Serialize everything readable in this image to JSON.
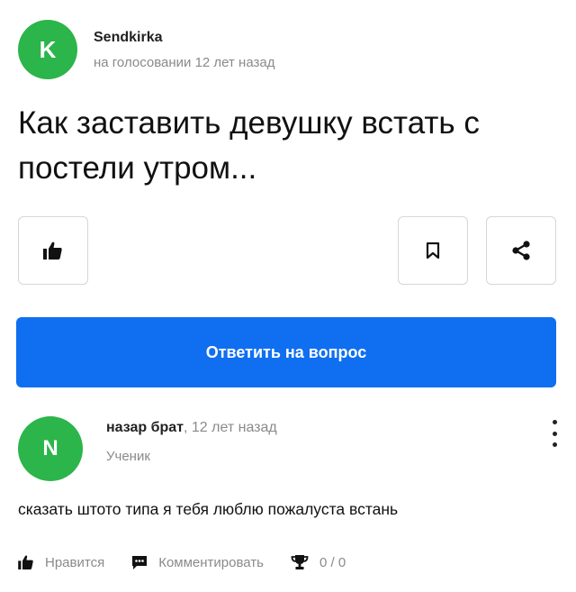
{
  "question": {
    "avatar_letter": "K",
    "avatar_color": "#2bb54a",
    "author": "Sendkirka",
    "subtitle": "на голосовании 12 лет назад",
    "title": "Как заставить девушку встать с постели утром..."
  },
  "actions": {
    "like_icon": "thumbs-up-icon",
    "bookmark_icon": "bookmark-icon",
    "share_icon": "share-icon"
  },
  "answer_button": {
    "label": "Ответить на вопрос",
    "color": "#0f6ff0"
  },
  "answer": {
    "avatar_letter": "N",
    "avatar_color": "#2bb54a",
    "author": "назар брат",
    "time": ", 12 лет назад",
    "role": "Ученик",
    "text": "сказать штото типа я тебя люблю пожалуста встань",
    "like_label": "Нравится",
    "comment_label": "Комментировать",
    "award_count": "0 / 0"
  }
}
